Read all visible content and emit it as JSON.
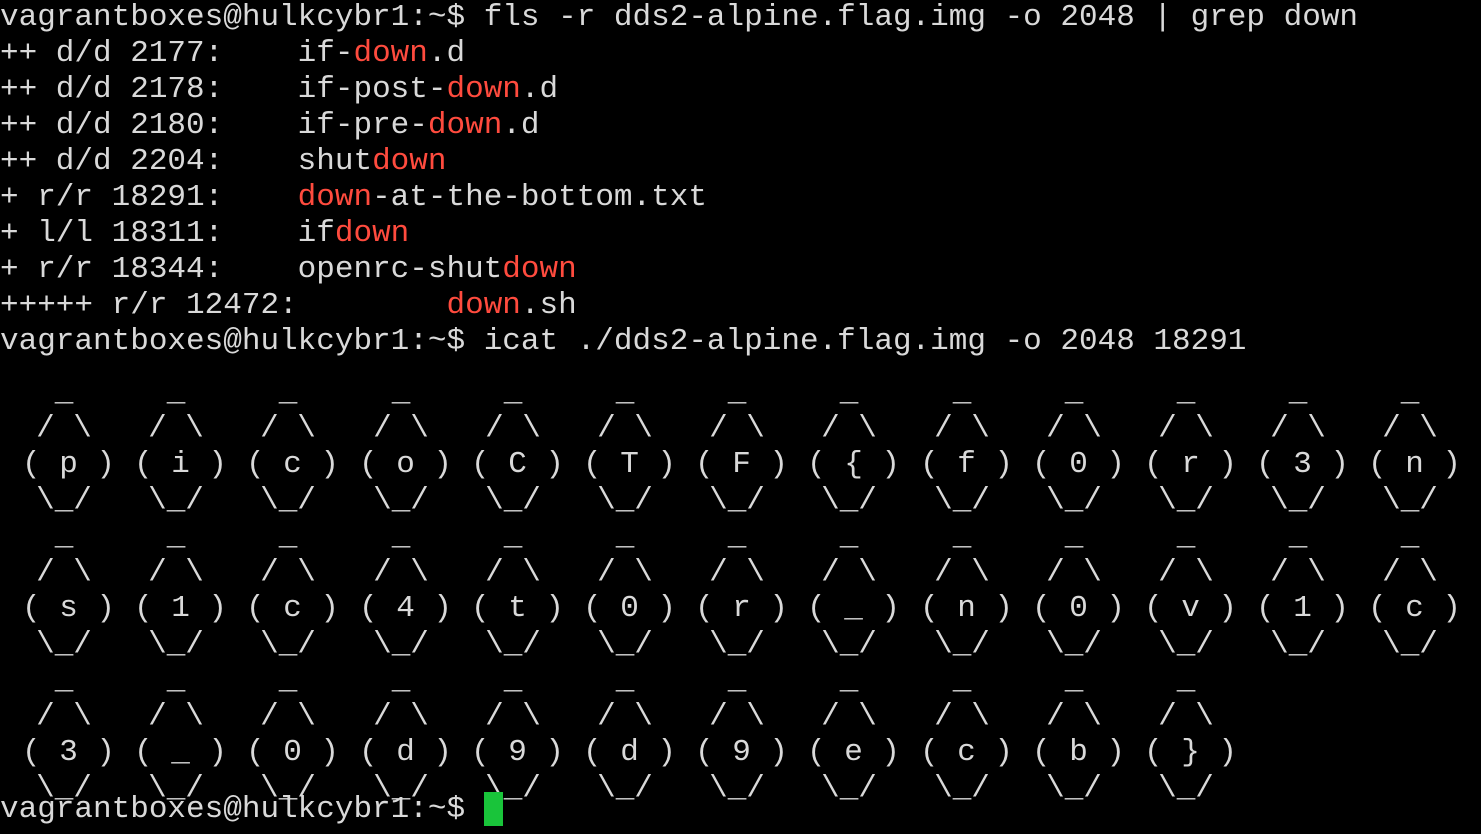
{
  "terminal": {
    "prompt": "vagrantboxes@hulkcybr1:~$",
    "command1": "fls -r dds2-alpine.flag.img -o 2048 | grep down",
    "command2": "icat ./dds2-alpine.flag.img -o 2048 18291",
    "highlight_color": "#ff4b3e",
    "cursor_color": "#19c43a",
    "output": [
      {
        "prefix": "++ d/d 2177:    ",
        "pre": "if-",
        "match": "down",
        "post": ".d"
      },
      {
        "prefix": "++ d/d 2178:    ",
        "pre": "if-post-",
        "match": "down",
        "post": ".d"
      },
      {
        "prefix": "++ d/d 2180:    ",
        "pre": "if-pre-",
        "match": "down",
        "post": ".d"
      },
      {
        "prefix": "++ d/d 2204:    ",
        "pre": "shut",
        "match": "down",
        "post": ""
      },
      {
        "prefix": "+ r/r 18291:    ",
        "pre": "",
        "match": "down",
        "post": "-at-the-bottom.txt"
      },
      {
        "prefix": "+ l/l 18311:    ",
        "pre": "if",
        "match": "down",
        "post": ""
      },
      {
        "prefix": "+ r/r 18344:    ",
        "pre": "openrc-shut",
        "match": "down",
        "post": ""
      },
      {
        "prefix": "+++++ r/r 12472:        ",
        "pre": "",
        "match": "down",
        "post": ".sh"
      }
    ],
    "ascii_art": {
      "top": " _ ",
      "upper": "/ \\",
      "lower": "\\_/",
      "rows": [
        [
          "p",
          "i",
          "c",
          "o",
          "C",
          "T",
          "F",
          "{",
          "f",
          "0",
          "r",
          "3",
          "n"
        ],
        [
          "s",
          "1",
          "c",
          "4",
          "t",
          "0",
          "r",
          "_",
          "n",
          "0",
          "v",
          "1",
          "c"
        ],
        [
          "3",
          "_",
          "0",
          "d",
          "9",
          "d",
          "9",
          "e",
          "c",
          "b",
          "}"
        ]
      ]
    }
  }
}
